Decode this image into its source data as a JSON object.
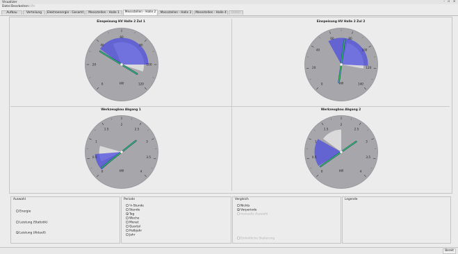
{
  "window": {
    "title": "Visualizer",
    "controls": "- ▫ ×"
  },
  "menu": [
    "Datei",
    "Bearbeiten",
    "Hilfe"
  ],
  "tabs": [
    {
      "label": "Aufbau"
    },
    {
      "label": "Verteilung"
    },
    {
      "label": "Elektroenergie - Gesamt"
    },
    {
      "label": "Messstellen - Halle 1"
    },
    {
      "label": "Messstellen - Halle 2",
      "active": true
    },
    {
      "label": "Messstellen - Halle 3"
    },
    {
      "label": "Messstellen - Halle 4"
    },
    {
      "label": "Daten",
      "disabled": true
    }
  ],
  "gauges": [
    {
      "title": "Einspeisung HV Halle 2 Zul 1",
      "unit": "kW",
      "ticks": [
        "0",
        "20",
        "40",
        "60",
        "80",
        "100",
        "120"
      ],
      "max": 120,
      "needle": 34,
      "blue_range": [
        36,
        100
      ],
      "grey_range": [
        50,
        108
      ]
    },
    {
      "title": "Einspeisung HV Halle 2 Zul 2",
      "unit": "kW",
      "ticks": [
        "0",
        "20",
        "40",
        "60",
        "80",
        "100",
        "120",
        "140"
      ],
      "max": 140,
      "needle": 74,
      "blue_range": [
        55,
        118
      ],
      "grey_range": [
        78,
        122
      ]
    },
    {
      "title": "Werkzeugbau Abgang 1",
      "unit": "kW",
      "ticks": [
        "0",
        "0.5",
        "1",
        "1.5",
        "2",
        "2.5",
        "3",
        "3.5",
        "4"
      ],
      "max": 4,
      "needle": 0.1,
      "blue_range": [
        0.05,
        0.6
      ],
      "grey_range": [
        0.3,
        0.9
      ]
    },
    {
      "title": "Werkzeugbau Abgang 2",
      "unit": "kW",
      "ticks": [
        "0",
        "0.5",
        "1",
        "1.5",
        "2",
        "2.5",
        "3",
        "3.5",
        "4"
      ],
      "max": 4,
      "needle": 0.15,
      "blue_range": [
        0.2,
        1.1
      ],
      "grey_range": [
        1.2,
        2.0
      ]
    }
  ],
  "colors": {
    "dial": "#a7a7ab",
    "blue": "#4a4ae0",
    "needle": "#2fbf54",
    "grey_band": "#dcdcdc",
    "needle_dark": "#1b2f8c"
  },
  "panels": {
    "auswahl": {
      "title": "Auswahl",
      "options": [
        {
          "label": "Energie",
          "checked": false
        },
        {
          "label": "Leistung (Statistik)",
          "checked": false
        },
        {
          "label": "Leistung (Aktuell)",
          "checked": true
        }
      ]
    },
    "periode": {
      "title": "Periode",
      "options": [
        {
          "label": "¼-Stunde",
          "checked": false
        },
        {
          "label": "Stunde",
          "checked": false
        },
        {
          "label": "Tag",
          "checked": true
        },
        {
          "label": "Woche",
          "checked": false
        },
        {
          "label": "Monat",
          "checked": false
        },
        {
          "label": "Quartal",
          "checked": false
        },
        {
          "label": "Halbjahr",
          "checked": false
        },
        {
          "label": "Jahr",
          "checked": false
        }
      ]
    },
    "vergleich": {
      "title": "Vergleich",
      "options": [
        {
          "label": "Nichts",
          "checked": false
        },
        {
          "label": "Vorperiode",
          "checked": true
        },
        {
          "label": "manuelle Auswahl",
          "checked": false,
          "disabled": true
        }
      ],
      "checkbox": "Einheitliche Skalierung"
    },
    "legende": {
      "title": "Legende"
    }
  },
  "status": "Bereit"
}
